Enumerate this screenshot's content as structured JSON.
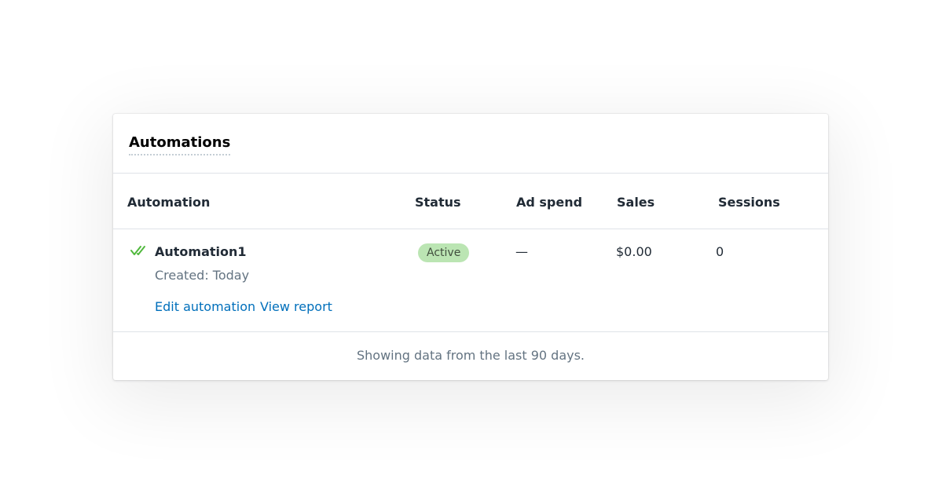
{
  "card": {
    "title": "Automations"
  },
  "table": {
    "columns": {
      "automation": "Automation",
      "status": "Status",
      "ad_spend": "Ad spend",
      "sales": "Sales",
      "sessions": "Sessions"
    },
    "rows": [
      {
        "icon": "double-check-icon",
        "name": "Automation1",
        "created": "Created: Today",
        "edit_label": "Edit automation",
        "view_label": "View report",
        "status": "Active",
        "ad_spend": "—",
        "sales": "$0.00",
        "sessions": "0"
      }
    ]
  },
  "footer": {
    "note": "Showing data from the last 90 days."
  },
  "colors": {
    "link": "#006fbb",
    "badge_bg": "#bbe5b3",
    "check": "#50b83c"
  }
}
